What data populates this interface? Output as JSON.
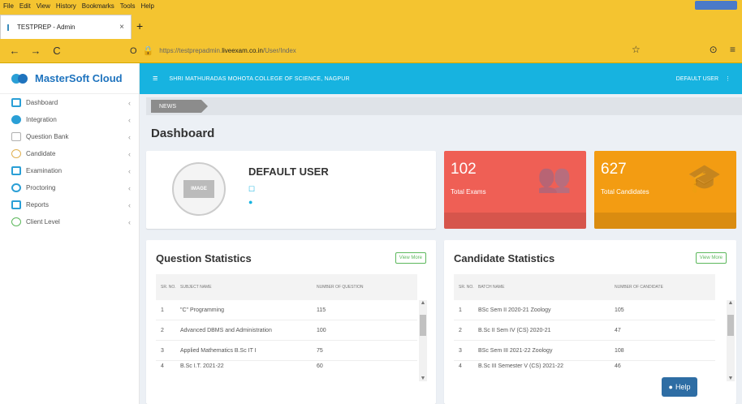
{
  "browser": {
    "menu": [
      "File",
      "Edit",
      "View",
      "History",
      "Bookmarks",
      "Tools",
      "Help"
    ],
    "tab_title": "TESTPREP - Admin",
    "tab_close": "×",
    "new_tab": "+",
    "url_prefix": "https://testprepadmin.",
    "url_domain": "liveexam.co.in",
    "url_path": "/User/Index",
    "back": "←",
    "forward": "→",
    "reload": "C",
    "shield": "O",
    "lock": "🔒",
    "star": "☆",
    "pocket": "⊙",
    "hamburger": "≡"
  },
  "sidebar": {
    "brand": "MasterSoft Cloud",
    "items": [
      {
        "label": "Dashboard",
        "color": "#2a9fd6"
      },
      {
        "label": "Integration",
        "color": "#2a9fd6"
      },
      {
        "label": "Question Bank",
        "color": "#b0b0b0"
      },
      {
        "label": "Candidate",
        "color": "#e0b050"
      },
      {
        "label": "Examination",
        "color": "#2a9fd6"
      },
      {
        "label": "Proctoring",
        "color": "#2a9fd6"
      },
      {
        "label": "Reports",
        "color": "#2a9fd6"
      },
      {
        "label": "Client Level",
        "color": "#5cb85c"
      }
    ],
    "chevron": "‹"
  },
  "topnav": {
    "menu_icon": "≡",
    "college": "SHRI MATHURADAS MOHOTA COLLEGE OF SCIENCE, NAGPUR",
    "user": "DEFAULT USER",
    "user_sep": "⋮"
  },
  "breadcrumb": "NEWS",
  "page_title": "Dashboard",
  "profile": {
    "name": "DEFAULT USER",
    "image_text": "IMAGE",
    "phone_icon": "☐",
    "globe_icon": "●"
  },
  "stats": {
    "exams": {
      "value": "102",
      "label": "Total Exams",
      "icon": "👥"
    },
    "candidates": {
      "value": "627",
      "label": "Total Candidates",
      "icon": "🎓"
    }
  },
  "question_stats": {
    "title": "Question Statistics",
    "view_more": "View More",
    "headers": [
      "SR. NO.",
      "SUBJECT NAME",
      "NUMBER OF QUESTION"
    ],
    "rows": [
      [
        "1",
        "\"C\" Programming",
        "115"
      ],
      [
        "2",
        "Advanced DBMS and Administration",
        "100"
      ],
      [
        "3",
        "Applied Mathematics B.Sc IT I",
        "75"
      ],
      [
        "4",
        "B.Sc I.T. 2021-22",
        "60"
      ]
    ]
  },
  "candidate_stats": {
    "title": "Candidate Statistics",
    "view_more": "View More",
    "headers": [
      "SR. NO.",
      "BATCH NAME",
      "NUMBER OF CANDIDATE"
    ],
    "rows": [
      [
        "1",
        "BSc Sem II 2020-21 Zoology",
        "105"
      ],
      [
        "2",
        "B.Sc II Sem IV (CS) 2020-21",
        "47"
      ],
      [
        "3",
        "BSc Sem III 2021-22 Zoology",
        "108"
      ],
      [
        "4",
        "B.Sc III Semester V (CS) 2021-22",
        "46"
      ]
    ]
  },
  "help": "Help"
}
